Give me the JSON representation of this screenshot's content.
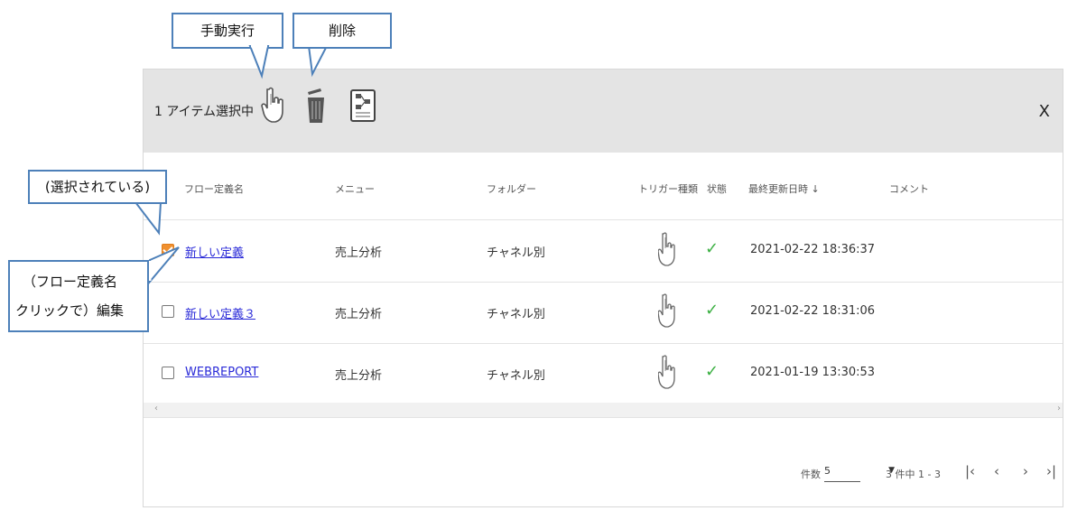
{
  "toolbar": {
    "selection_text": "1 アイテム選択中",
    "close_label": "X"
  },
  "columns": [
    "フロー定義名",
    "メニュー",
    "フォルダー",
    "トリガー種類",
    "状態",
    "最終更新日時 ↓",
    "コメント"
  ],
  "rows": [
    {
      "name": "新しい定義",
      "menu": "売上分析",
      "folder": "チャネル別",
      "status": "✓",
      "updated": "2021-02-22 18:36:37",
      "checked": true
    },
    {
      "name": "新しい定義３",
      "menu": "売上分析",
      "folder": "チャネル別",
      "status": "✓",
      "updated": "2021-02-22 18:31:06",
      "checked": false
    },
    {
      "name": "WEBREPORT",
      "menu": "売上分析",
      "folder": "チャネル別",
      "status": "✓",
      "updated": "2021-01-19 13:30:53",
      "checked": false
    }
  ],
  "scroll": {
    "left": "‹",
    "right": "›"
  },
  "pagination": {
    "count_label": "件数",
    "page_size": "5",
    "dropdown_arrow": "▼",
    "range_text": "3 件中 1 - 3",
    "first": "|‹",
    "prev": "‹",
    "next": "›",
    "last": "›|"
  },
  "callouts": {
    "manual_run": "手動実行",
    "delete": "削除",
    "selected": "(選択されている)",
    "edit_line1": "（フロー定義名",
    "edit_line2": "クリックで）編集"
  },
  "colors": {
    "link": "#2a2ad8",
    "checkbox_checked": "#f0902f",
    "status_ok": "#3cb043",
    "callout_border": "#4d80b9"
  },
  "icons": {
    "run": "hand-pointer-icon",
    "delete": "trash-icon",
    "detail": "flow-diagram-icon",
    "trigger": "hand-pointer-icon"
  }
}
